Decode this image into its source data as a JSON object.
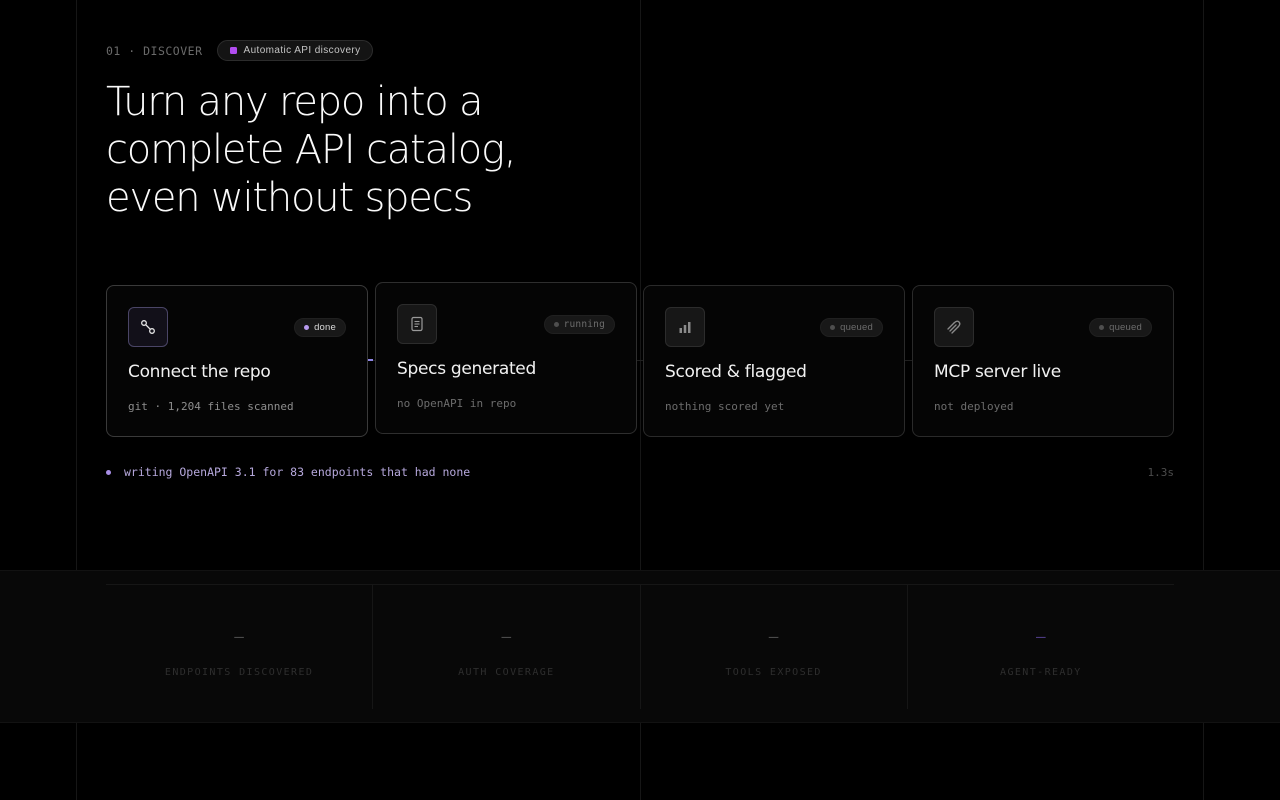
{
  "eyebrow": {
    "step": "01 · DISCOVER",
    "tag": "Automatic API discovery"
  },
  "headline": {
    "lines": [
      "Turn any repo into a",
      "complete API catalog,",
      "even without specs"
    ]
  },
  "steps": [
    {
      "icon": "link-nodes-icon",
      "status": "done",
      "title": "Connect the repo",
      "subtitle": "git · 1,204 files scanned"
    },
    {
      "icon": "document-icon",
      "status": "running",
      "title": "Specs generated",
      "subtitle": "no OpenAPI in repo"
    },
    {
      "icon": "bar-chart-icon",
      "status": "queued",
      "title": "Scored & flagged",
      "subtitle": "nothing scored yet"
    },
    {
      "icon": "plug-icon",
      "status": "queued",
      "title": "MCP server live",
      "subtitle": "not deployed"
    }
  ],
  "log": {
    "message": "writing OpenAPI 3.1 for 83 endpoints that had none",
    "elapsed": "1.3s"
  },
  "stats": [
    {
      "value": "–",
      "label": "ENDPOINTS DISCOVERED"
    },
    {
      "value": "–",
      "label": "AUTH COVERAGE"
    },
    {
      "value": "–",
      "label": "TOOLS EXPOSED"
    },
    {
      "value": "–",
      "label": "AGENT-READY"
    }
  ],
  "colors": {
    "background": "#000000",
    "accent_purple": "#b14cf0",
    "accent_lavender": "#a98fe6",
    "muted_text": "#6c6c6c"
  }
}
